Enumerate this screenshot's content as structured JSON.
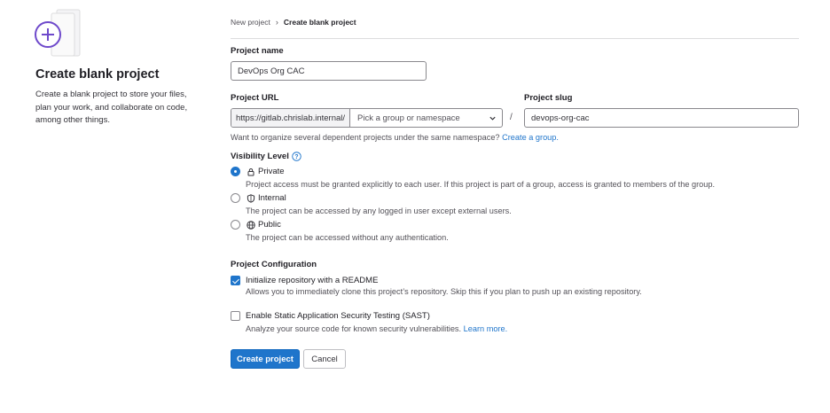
{
  "left": {
    "title": "Create blank project",
    "description": "Create a blank project to store your files, plan your work, and collaborate on code, among other things."
  },
  "breadcrumb": {
    "parent": "New project",
    "current": "Create blank project"
  },
  "project_name": {
    "label": "Project name",
    "value": "DevOps Org CAC"
  },
  "project_url": {
    "label": "Project URL",
    "prefix": "https://gitlab.chrislab.internal/",
    "namespace_placeholder": "Pick a group or namespace",
    "separator": "/"
  },
  "project_slug": {
    "label": "Project slug",
    "value": "devops-org-cac"
  },
  "namespace_help": {
    "text": "Want to organize several dependent projects under the same namespace?",
    "link": "Create a group."
  },
  "visibility": {
    "label": "Visibility Level",
    "options": [
      {
        "label": "Private",
        "icon": "lock-icon",
        "checked": true,
        "description": "Project access must be granted explicitly to each user. If this project is part of a group, access is granted to members of the group."
      },
      {
        "label": "Internal",
        "icon": "shield-icon",
        "checked": false,
        "description": "The project can be accessed by any logged in user except external users."
      },
      {
        "label": "Public",
        "icon": "globe-icon",
        "checked": false,
        "description": "The project can be accessed without any authentication."
      }
    ]
  },
  "config": {
    "label": "Project Configuration",
    "readme": {
      "label": "Initialize repository with a README",
      "checked": true,
      "description": "Allows you to immediately clone this project’s repository. Skip this if you plan to push up an existing repository."
    },
    "sast": {
      "label": "Enable Static Application Security Testing (SAST)",
      "checked": false,
      "description": "Analyze your source code for known security vulnerabilities.",
      "link": "Learn more."
    }
  },
  "buttons": {
    "create": "Create project",
    "cancel": "Cancel"
  },
  "colors": {
    "accent": "#1f75cb",
    "illustration": "#6e49cb"
  }
}
